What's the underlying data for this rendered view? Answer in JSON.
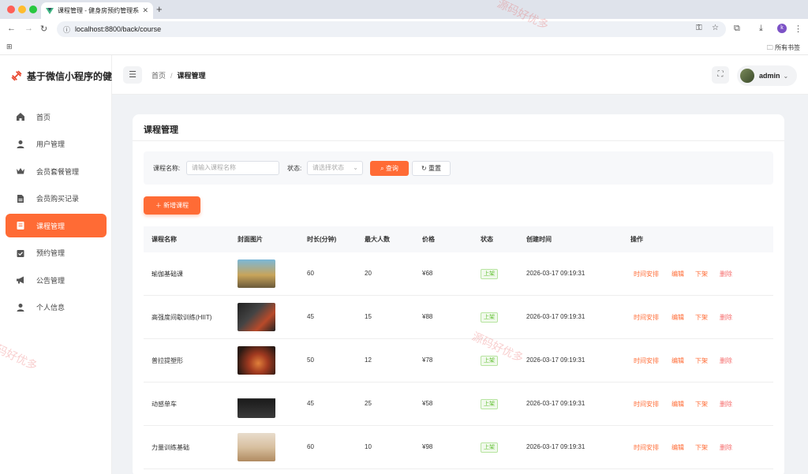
{
  "browser": {
    "tab_title": "课程管理 - 健身房预约管理系统",
    "url": "localhost:8800/back/course",
    "profile_initial": "k",
    "bookmarks_all": "所有书签"
  },
  "app": {
    "logo_text": "基于微信小程序的健",
    "menu": [
      {
        "label": "首页",
        "icon": "home-icon"
      },
      {
        "label": "用户管理",
        "icon": "user-icon"
      },
      {
        "label": "会员套餐管理",
        "icon": "crown-icon"
      },
      {
        "label": "会员购买记录",
        "icon": "document-icon"
      },
      {
        "label": "课程管理",
        "icon": "course-icon"
      },
      {
        "label": "预约管理",
        "icon": "calendar-check-icon"
      },
      {
        "label": "公告管理",
        "icon": "megaphone-icon"
      },
      {
        "label": "个人信息",
        "icon": "person-icon"
      }
    ],
    "active_menu": "课程管理",
    "accent_color": "#ff6b35"
  },
  "header": {
    "breadcrumb": [
      "首页",
      "课程管理"
    ],
    "username": "admin"
  },
  "page": {
    "title": "课程管理",
    "search": {
      "name_label": "课程名称:",
      "name_placeholder": "请输入课程名称",
      "status_label": "状态:",
      "status_placeholder": "请选择状态",
      "query_button": "查询",
      "reset_button": "重置"
    },
    "add_button": "新增课程",
    "table": {
      "columns": [
        "课程名称",
        "封面图片",
        "时长(分钟)",
        "最大人数",
        "价格",
        "状态",
        "创建时间",
        "操作"
      ],
      "rows": [
        {
          "name": "瑜伽基础课",
          "duration": "60",
          "max": "20",
          "price": "¥68",
          "status": "上架",
          "created": "2026-03-17 09:19:31"
        },
        {
          "name": "高强度间歇训练(HIIT)",
          "duration": "45",
          "max": "15",
          "price": "¥88",
          "status": "上架",
          "created": "2026-03-17 09:19:31"
        },
        {
          "name": "普拉提塑形",
          "duration": "50",
          "max": "12",
          "price": "¥78",
          "status": "上架",
          "created": "2026-03-17 09:19:31"
        },
        {
          "name": "动感单车",
          "duration": "45",
          "max": "25",
          "price": "¥58",
          "status": "上架",
          "created": "2026-03-17 09:19:31"
        },
        {
          "name": "力量训练基础",
          "duration": "60",
          "max": "10",
          "price": "¥98",
          "status": "上架",
          "created": "2026-03-17 09:19:31"
        }
      ],
      "actions": [
        "时间安排",
        "编辑",
        "下架",
        "删除"
      ]
    }
  },
  "watermark": "源码好优多"
}
